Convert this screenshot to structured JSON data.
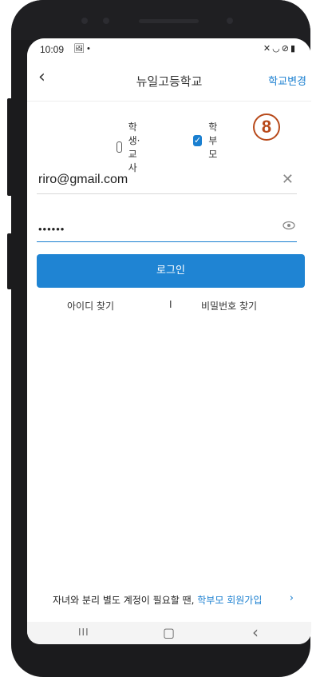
{
  "status_bar": {
    "time": "10:09",
    "left_icons": "🖼 •",
    "right_icons": "✕◡⊘▮"
  },
  "app_bar": {
    "back_label": "‹",
    "title": "뉴일고등학교",
    "change_school_label": "학교변경"
  },
  "roles": {
    "student_teacher": {
      "label": "학생·교사",
      "checked": false
    },
    "parent": {
      "label": "학부모",
      "checked": true
    }
  },
  "annotation_badge": "8",
  "form": {
    "email_value": "riro@gmail.com",
    "password_value": "••••••",
    "clear_icon": "✕",
    "eye_icon": "👁"
  },
  "login_button_label": "로그인",
  "links": {
    "find_id": "아이디 찾기",
    "separator": "I",
    "find_password": "비밀번호 찾기"
  },
  "promo": {
    "text": "자녀와 분리 별도 계정이 필요할 땐, ",
    "link": "학부모 회원가입",
    "chevron": "›"
  },
  "nav": {
    "recent": "III",
    "home": "▢",
    "back": "‹"
  },
  "colors": {
    "accent": "#1a7fd0",
    "badge": "#b84a1b"
  }
}
